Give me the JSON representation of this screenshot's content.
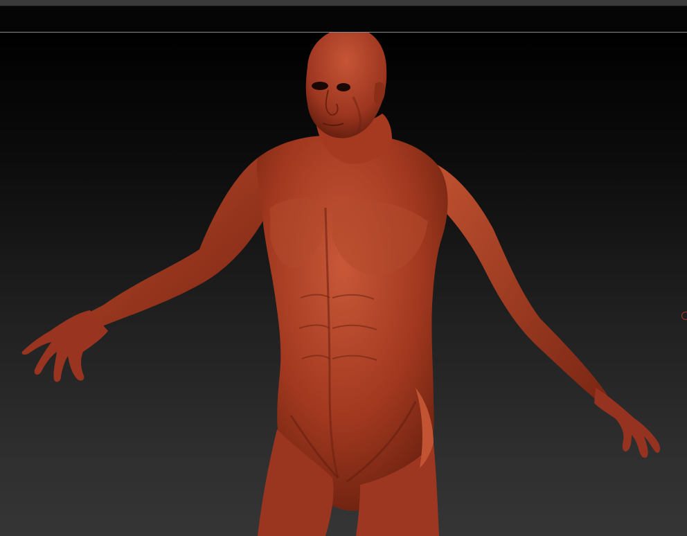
{
  "app": {
    "colors": {
      "top_bar": "#3a3a3a",
      "strip": "#050505",
      "strip_line": "#8d8d8d",
      "viewport_top": "#000000",
      "viewport_bottom": "#353535",
      "model_base": "#a1381f",
      "model_highlight": "#c85838",
      "model_shadow": "#5e1c0c"
    }
  },
  "viewport": {
    "model": {
      "name_icon": "sculpt-figure",
      "material": "red-wax"
    },
    "edge_marker_icon": "circle-marker-icon"
  }
}
